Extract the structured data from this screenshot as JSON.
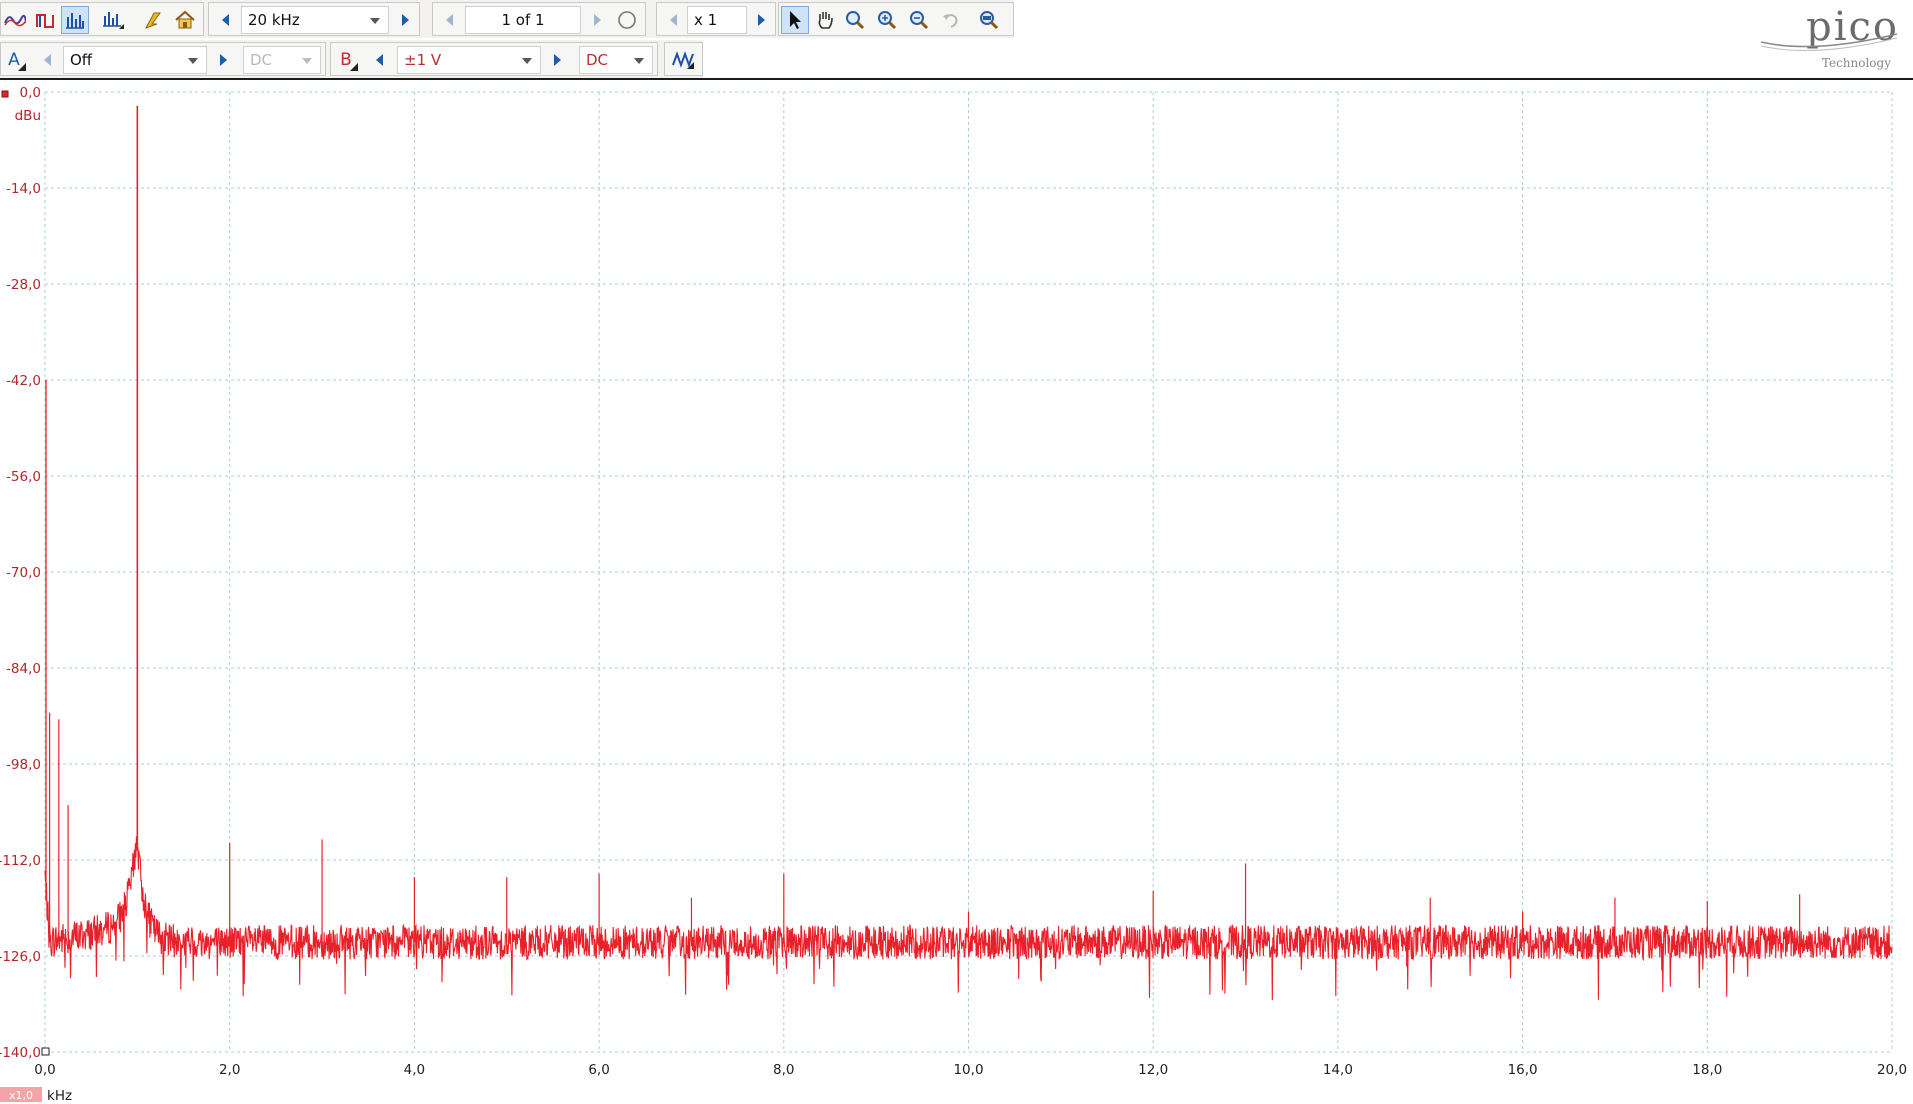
{
  "toolbar": {
    "timebase": "20 kHz",
    "page": "1 of 1",
    "zoom": "x 1",
    "view_buttons": [
      "scope-mode-icon",
      "persistence-mode-icon",
      "spectrum-mode-icon",
      "spectrum-options-icon",
      "trigger-icon",
      "home-icon"
    ],
    "tool_buttons": [
      "pointer-icon",
      "hand-pan-icon",
      "zoom-icon",
      "zoom-in-icon",
      "zoom-out-icon",
      "undo-zoom-icon",
      "zoom-overview-icon"
    ]
  },
  "channels": {
    "a": {
      "label": "A",
      "range": "Off",
      "coupling": "DC"
    },
    "b": {
      "label": "B",
      "range": "±1 V",
      "coupling": "DC"
    }
  },
  "logo": {
    "text": "pico",
    "subtitle": "Technology"
  },
  "chart_data": {
    "type": "line",
    "title": "",
    "ylabel": "dBu",
    "xlabel": "kHz",
    "xlim": [
      0,
      20
    ],
    "ylim": [
      -140,
      0
    ],
    "y_ticks": [
      "0,0",
      "-14,0",
      "-28,0",
      "-42,0",
      "-56,0",
      "-70,0",
      "-84,0",
      "-98,0",
      "-112,0",
      "-126,0",
      "-140,0"
    ],
    "x_ticks": [
      "0,0",
      "2,0",
      "4,0",
      "6,0",
      "8,0",
      "10,0",
      "12,0",
      "14,0",
      "16,0",
      "18,0",
      "20,0"
    ],
    "scale_badge": "x1,0",
    "grid": true,
    "series": [
      {
        "color": "#e8202a",
        "noise_floor": -124.0,
        "peaks": [
          {
            "x": 0.05,
            "y": -90.5
          },
          {
            "x": 0.15,
            "y": -91.5
          },
          {
            "x": 0.25,
            "y": -104.0
          },
          {
            "x": 1.0,
            "y": -2.0
          },
          {
            "x": 2.0,
            "y": -109.5
          },
          {
            "x": 3.0,
            "y": -109.0
          },
          {
            "x": 4.0,
            "y": -114.5
          },
          {
            "x": 5.0,
            "y": -114.5
          },
          {
            "x": 6.0,
            "y": -114.0
          },
          {
            "x": 7.0,
            "y": -117.5
          },
          {
            "x": 8.0,
            "y": -114.0
          },
          {
            "x": 10.0,
            "y": -119.5
          },
          {
            "x": 12.0,
            "y": -116.5
          },
          {
            "x": 13.0,
            "y": -112.5
          },
          {
            "x": 15.0,
            "y": -117.5
          },
          {
            "x": 16.0,
            "y": -119.5
          },
          {
            "x": 17.0,
            "y": -117.5
          },
          {
            "x": 18.0,
            "y": -118.0
          },
          {
            "x": 19.0,
            "y": -117.0
          }
        ]
      }
    ]
  }
}
